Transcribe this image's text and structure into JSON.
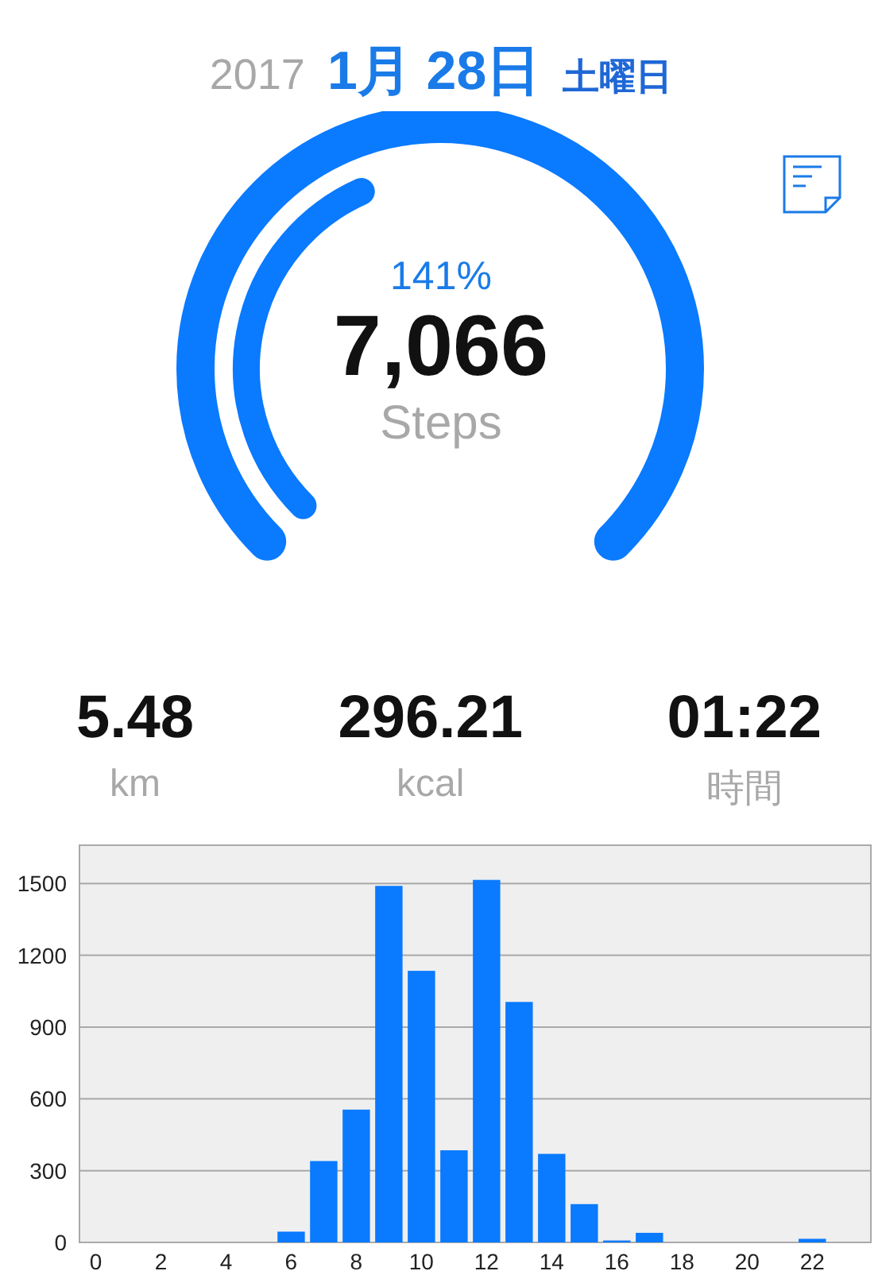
{
  "header": {
    "year": "2017",
    "date": "1月 28日",
    "weekday": "土曜日"
  },
  "gauge": {
    "percent": "141%",
    "steps": "7,066",
    "unit": "Steps"
  },
  "stats": [
    {
      "value": "5.48",
      "unit": "km"
    },
    {
      "value": "296.21",
      "unit": "kcal"
    },
    {
      "value": "01:22",
      "unit": "時間"
    }
  ],
  "chart": {
    "chart_data": {
      "type": "bar",
      "x": [
        0,
        1,
        2,
        3,
        4,
        5,
        6,
        7,
        8,
        9,
        10,
        11,
        12,
        13,
        14,
        15,
        16,
        17,
        18,
        19,
        20,
        21,
        22,
        23
      ],
      "series": [
        {
          "color": "#0a7aff",
          "values": [
            0,
            0,
            0,
            0,
            0,
            0,
            45,
            340,
            555,
            1490,
            1135,
            385,
            1515,
            1005,
            370,
            160,
            8,
            40,
            0,
            0,
            0,
            0,
            15,
            0
          ]
        }
      ],
      "xlim": [
        -0.5,
        23.8
      ],
      "ylim": [
        0,
        1660
      ],
      "xticks": [
        0,
        2,
        4,
        6,
        8,
        10,
        12,
        14,
        16,
        18,
        20,
        22
      ],
      "yticks": [
        0,
        300,
        600,
        900,
        1200,
        1500
      ],
      "grid": true
    }
  }
}
